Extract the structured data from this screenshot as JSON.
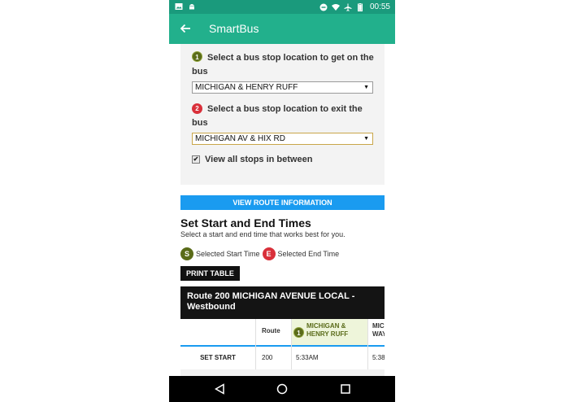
{
  "status_bar": {
    "time": "00:55",
    "icons": [
      "image-icon",
      "android-icon",
      "dnd-icon",
      "wifi-icon",
      "airplane-icon",
      "battery-icon"
    ]
  },
  "app_bar": {
    "title": "SmartBus"
  },
  "get_on": {
    "number": "1",
    "label": "Select a bus stop location to get on the bus",
    "value": "MICHIGAN & HENRY RUFF"
  },
  "exit": {
    "number": "2",
    "label": "Select a bus stop location to exit the bus",
    "value": "MICHIGAN AV & HIX RD"
  },
  "view_all_stops": {
    "label": "View all stops in between",
    "checked": true
  },
  "route_info_button": "VIEW ROUTE INFORMATION",
  "times": {
    "heading": "Set Start and End Times",
    "subtitle": "Select a start and end time that works best for you.",
    "legend_start_letter": "S",
    "legend_start_label": "Selected Start Time",
    "legend_end_letter": "E",
    "legend_end_label": "Selected End Time"
  },
  "print_button": "PRINT TABLE",
  "route_header": "Route 200 MICHIGAN AVENUE LOCAL - Westbound",
  "table": {
    "columns": [
      "",
      "Route",
      "MICHIGAN & HENRY RUFF",
      "MIC WAY"
    ],
    "stop_number": "1",
    "rows": [
      [
        "SET START",
        "200",
        "5:33AM",
        "5:38"
      ]
    ]
  },
  "colors": {
    "status_bar": "#1a9a7c",
    "app_bar": "#22b08c",
    "accent_blue": "#1a9bf0",
    "start_green": "#5a6b19",
    "end_red": "#d9303a"
  }
}
